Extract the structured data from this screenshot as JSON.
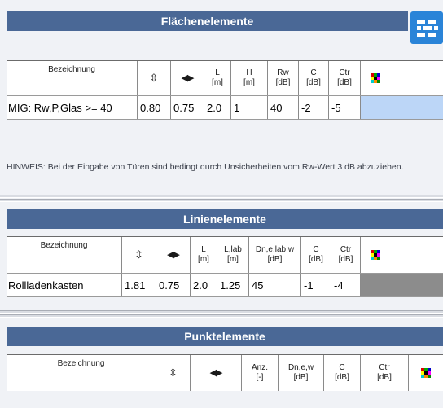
{
  "colors": {
    "title_bar": "#4a6896",
    "selected_cell": "#bcd6f7",
    "grey_cell": "#8c8c8c",
    "background": "#f0f2f6"
  },
  "flaechen": {
    "title": "Flächenelemente",
    "header": {
      "bez": "Bezeichnung",
      "l": "L",
      "l_u": "[m]",
      "h": "H",
      "h_u": "[m]",
      "rw": "Rw",
      "rw_u": "[dB]",
      "c": "C",
      "c_u": "[dB]",
      "ctr": "Ctr",
      "ctr_u": "[dB]"
    },
    "row": {
      "bez": "MIG: Rw,P,Glas >= 40",
      "v1": "0.80",
      "v2": "0.75",
      "l": "2.0",
      "h": "1",
      "rw": "40",
      "c": "-2",
      "ctr": "-5"
    }
  },
  "hinweis": "HINWEIS: Bei der Eingabe von Türen sind bedingt durch Unsicherheiten vom Rw-Wert 3 dB abzuziehen.",
  "linien": {
    "title": "Linienelemente",
    "header": {
      "bez": "Bezeichnung",
      "l": "L",
      "l_u": "[m]",
      "llab": "L,lab",
      "llab_u": "[m]",
      "dn": "Dn,e,lab,w",
      "dn_u": "[dB]",
      "c": "C",
      "c_u": "[dB]",
      "ctr": "Ctr",
      "ctr_u": "[dB]"
    },
    "row": {
      "bez": "Rollladenkasten",
      "v1": "1.81",
      "v2": "0.75",
      "l": "2.0",
      "llab": "1.25",
      "dn": "45",
      "c": "-1",
      "ctr": "-4"
    }
  },
  "punkt": {
    "title": "Punktelemente",
    "header": {
      "bez": "Bezeichnung",
      "anz": "Anz.",
      "anz_u": "[-]",
      "dn": "Dn,e,w",
      "dn_u": "[dB]",
      "c": "C",
      "c_u": "[dB]",
      "ctr": "Ctr",
      "ctr_u": "[dB]"
    }
  }
}
